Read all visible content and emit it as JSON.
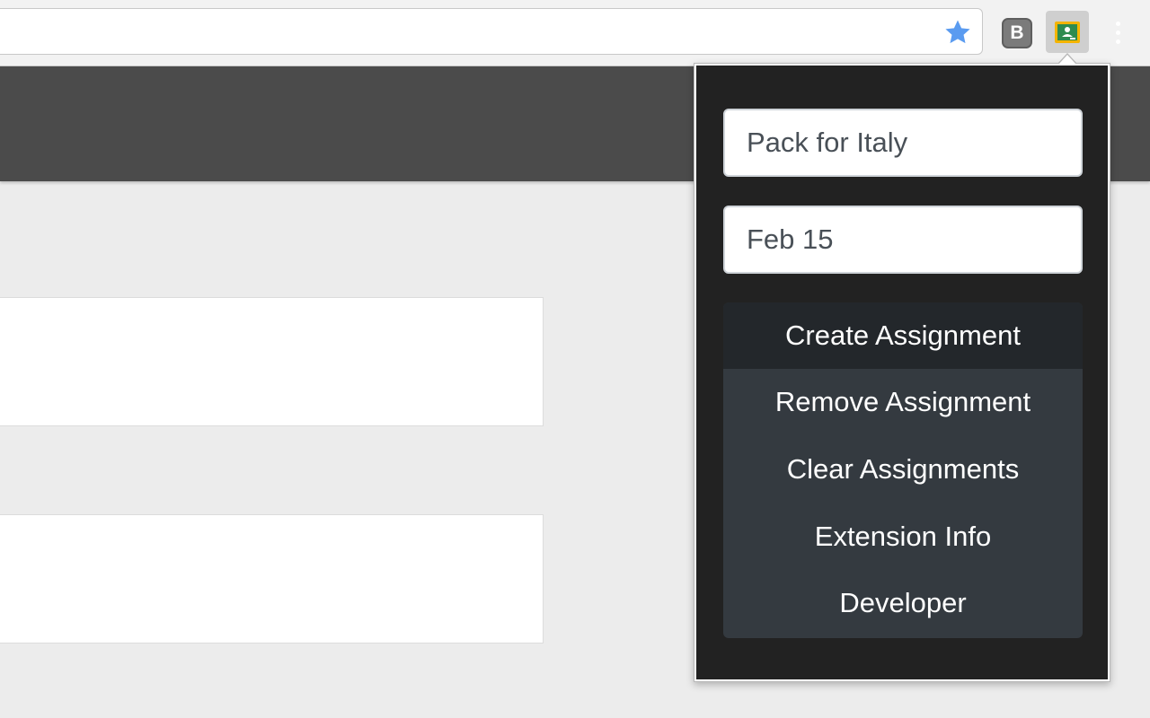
{
  "browser": {
    "extensions": [
      {
        "name": "b-extension",
        "label": "B"
      },
      {
        "name": "google-classroom-extension"
      }
    ],
    "icons": [
      "star-icon",
      "b-extension-icon",
      "classroom-icon",
      "kebab-menu-icon"
    ],
    "star_color": "#5a9bf0"
  },
  "popup": {
    "assignment_input": {
      "value": "Pack for Italy",
      "placeholder": ""
    },
    "date_input": {
      "value": "Feb 15",
      "placeholder": ""
    },
    "menu": [
      {
        "label": "Create Assignment",
        "active": true
      },
      {
        "label": "Remove Assignment",
        "active": false
      },
      {
        "label": "Clear Assignments",
        "active": false
      },
      {
        "label": "Extension Info",
        "active": false
      },
      {
        "label": "Developer",
        "active": false
      }
    ],
    "colors": {
      "background": "#222222",
      "list_bg": "#343a40",
      "list_active_bg": "#23272b",
      "text": "#ffffff"
    }
  },
  "page": {
    "header_color": "#4b4b4b",
    "background": "#ececec"
  }
}
